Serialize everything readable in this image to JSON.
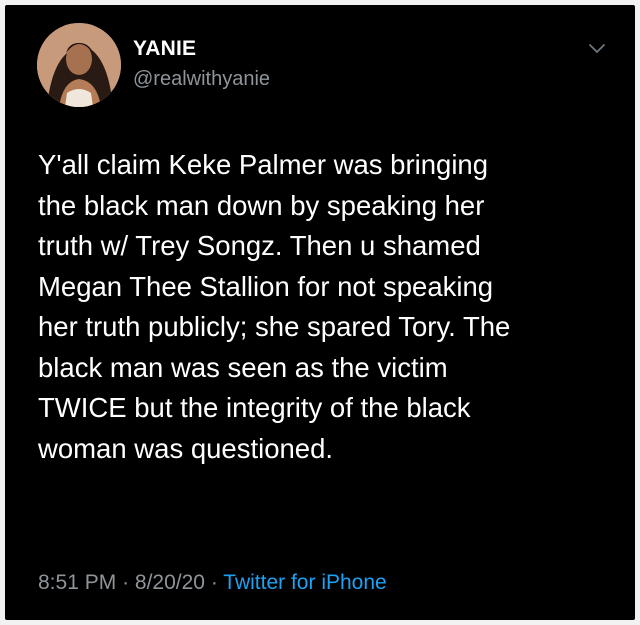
{
  "user": {
    "name": "YANIE",
    "handle": "@realwithyanie"
  },
  "tweet": {
    "lines": [
      "Y'all claim Keke Palmer was bringing",
      "the black man down by speaking her",
      "truth w/ Trey Songz. Then u shamed",
      "Megan Thee Stallion for not speaking",
      "her truth publicly; she spared Tory. The",
      "black man was seen as the victim",
      "TWICE but the integrity of the black",
      "woman was questioned."
    ]
  },
  "meta": {
    "time": "8:51 PM",
    "separator": "·",
    "date": "8/20/20",
    "source": "Twitter for iPhone"
  },
  "icons": {
    "avatar": "profile-photo",
    "menu": "chevron-down-icon"
  },
  "colors": {
    "background": "#000000",
    "text": "#ffffff",
    "secondary": "#8e9499",
    "link": "#1da1f2"
  }
}
